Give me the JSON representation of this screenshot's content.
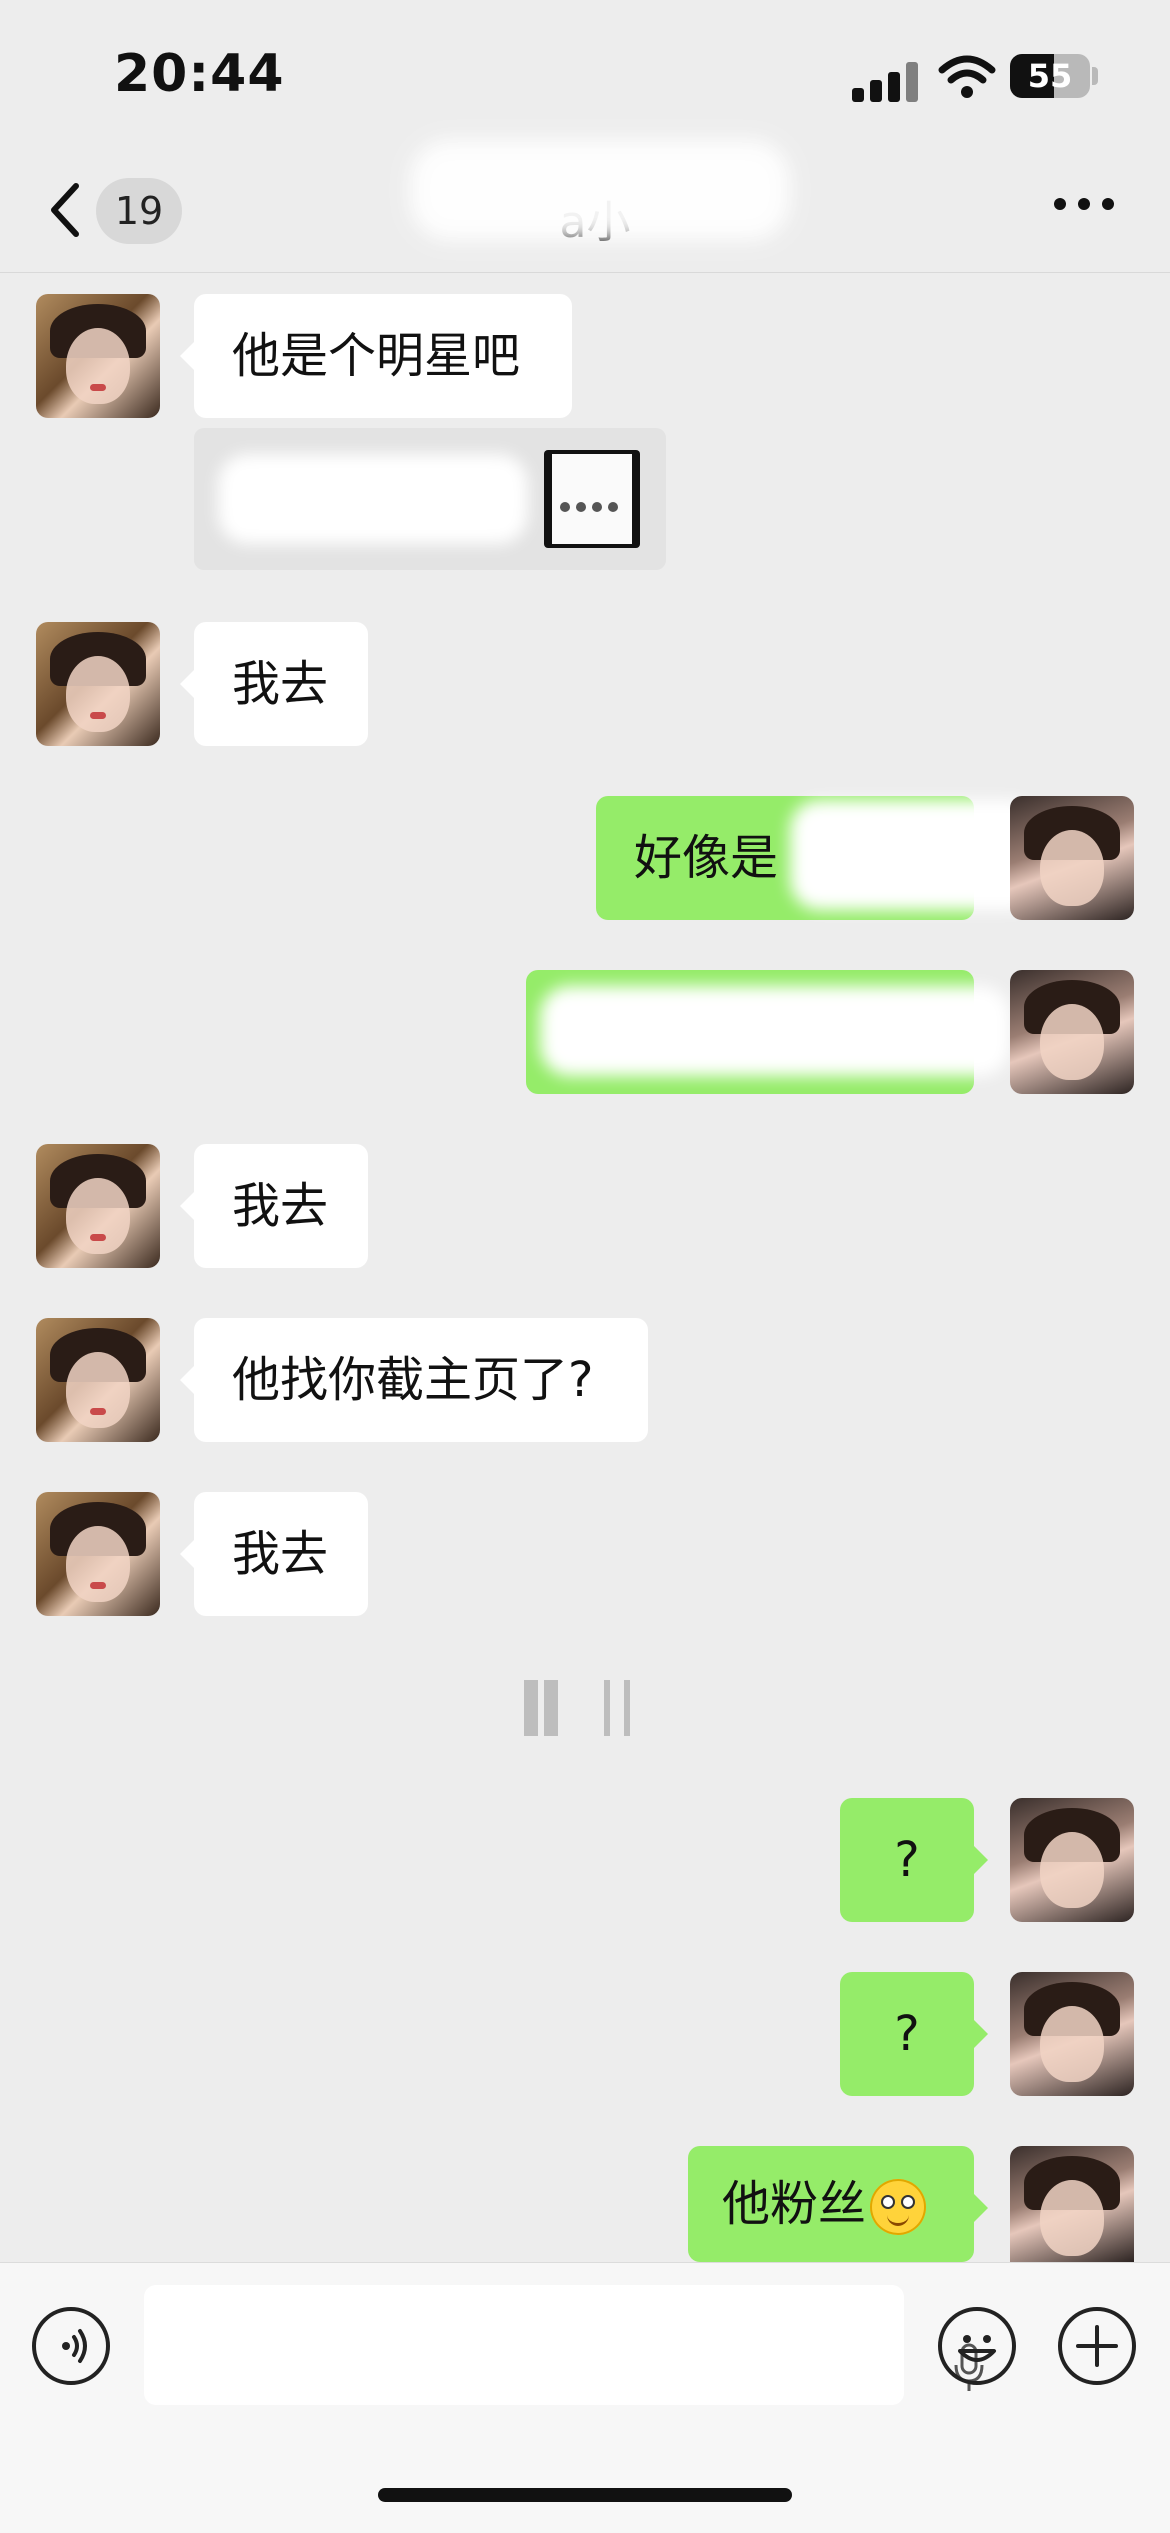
{
  "status_bar": {
    "time": "20:44",
    "battery": "55",
    "battery_level": 0.55,
    "icons": [
      "signal-icon",
      "wifi-icon",
      "battery-icon"
    ]
  },
  "nav": {
    "back_icon": "chevron-left-icon",
    "unread_count": "19",
    "title": "a小",
    "more_icon": "more-dots-icon"
  },
  "messages": [
    {
      "side": "left",
      "text": "他是个明星吧"
    },
    {
      "side": "left",
      "type": "card",
      "text": ""
    },
    {
      "side": "left",
      "text": "我去"
    },
    {
      "side": "right",
      "text": "好像是"
    },
    {
      "side": "right",
      "text": ""
    },
    {
      "side": "left",
      "text": "我去"
    },
    {
      "side": "left",
      "text": "他找你截主页了?"
    },
    {
      "side": "left",
      "text": "我去"
    },
    {
      "side": "right",
      "text": "?"
    },
    {
      "side": "right",
      "text": "?"
    },
    {
      "side": "right",
      "text": "他粉丝",
      "emoji": "smile-emoji"
    }
  ],
  "input_bar": {
    "voice_icon": "voice-icon",
    "mic_icon": "mic-icon",
    "emoji_icon": "emoji-icon",
    "plus_icon": "plus-icon",
    "placeholder": ""
  },
  "colors": {
    "background": "#ededed",
    "self_bubble": "#95ec69",
    "other_bubble": "#ffffff"
  }
}
